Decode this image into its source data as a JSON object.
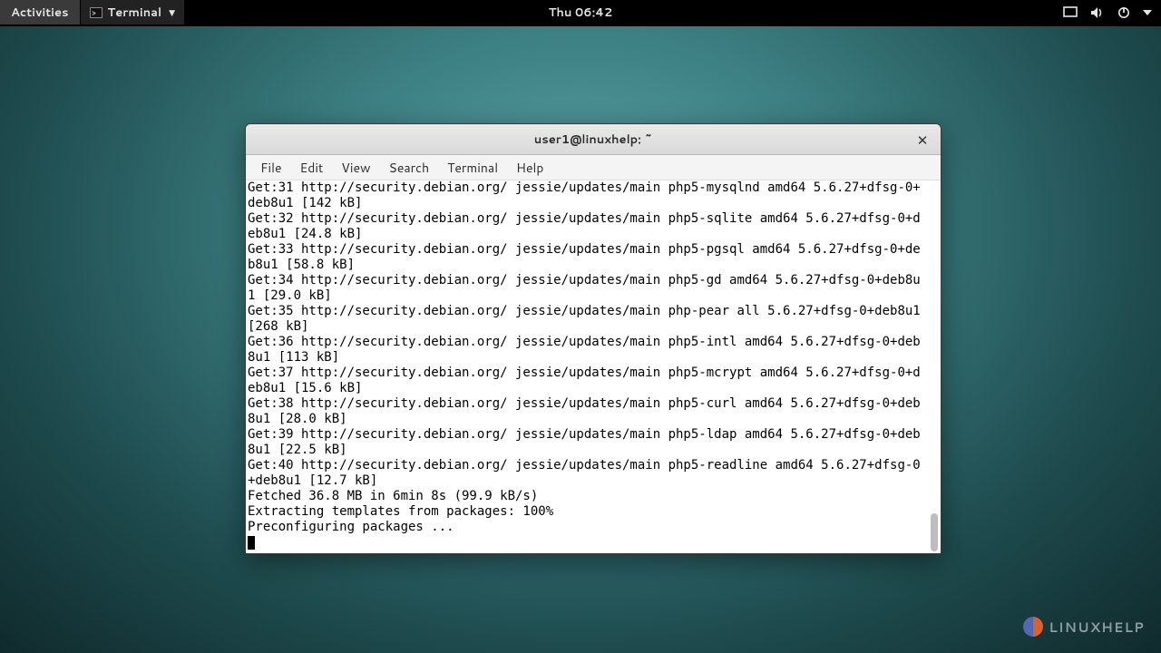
{
  "topbar": {
    "activities": "Activities",
    "app_label": "Terminal",
    "clock": "Thu 06:42"
  },
  "window": {
    "title": "user1@linuxhelp: ~",
    "menu": {
      "file": "File",
      "edit": "Edit",
      "view": "View",
      "search": "Search",
      "terminal": "Terminal",
      "help": "Help"
    }
  },
  "terminal": {
    "lines": [
      "Get:31 http://security.debian.org/ jessie/updates/main php5-mysqlnd amd64 5.6.27+dfsg-0+deb8u1 [142 kB]",
      "Get:32 http://security.debian.org/ jessie/updates/main php5-sqlite amd64 5.6.27+dfsg-0+deb8u1 [24.8 kB]",
      "Get:33 http://security.debian.org/ jessie/updates/main php5-pgsql amd64 5.6.27+dfsg-0+deb8u1 [58.8 kB]",
      "Get:34 http://security.debian.org/ jessie/updates/main php5-gd amd64 5.6.27+dfsg-0+deb8u1 [29.0 kB]",
      "Get:35 http://security.debian.org/ jessie/updates/main php-pear all 5.6.27+dfsg-0+deb8u1 [268 kB]",
      "Get:36 http://security.debian.org/ jessie/updates/main php5-intl amd64 5.6.27+dfsg-0+deb8u1 [113 kB]",
      "Get:37 http://security.debian.org/ jessie/updates/main php5-mcrypt amd64 5.6.27+dfsg-0+deb8u1 [15.6 kB]",
      "Get:38 http://security.debian.org/ jessie/updates/main php5-curl amd64 5.6.27+dfsg-0+deb8u1 [28.0 kB]",
      "Get:39 http://security.debian.org/ jessie/updates/main php5-ldap amd64 5.6.27+dfsg-0+deb8u1 [22.5 kB]",
      "Get:40 http://security.debian.org/ jessie/updates/main php5-readline amd64 5.6.27+dfsg-0+deb8u1 [12.7 kB]",
      "Fetched 36.8 MB in 6min 8s (99.9 kB/s)",
      "Extracting templates from packages: 100%",
      "Preconfiguring packages ..."
    ]
  },
  "watermark": {
    "text": "LINUXHELP"
  }
}
